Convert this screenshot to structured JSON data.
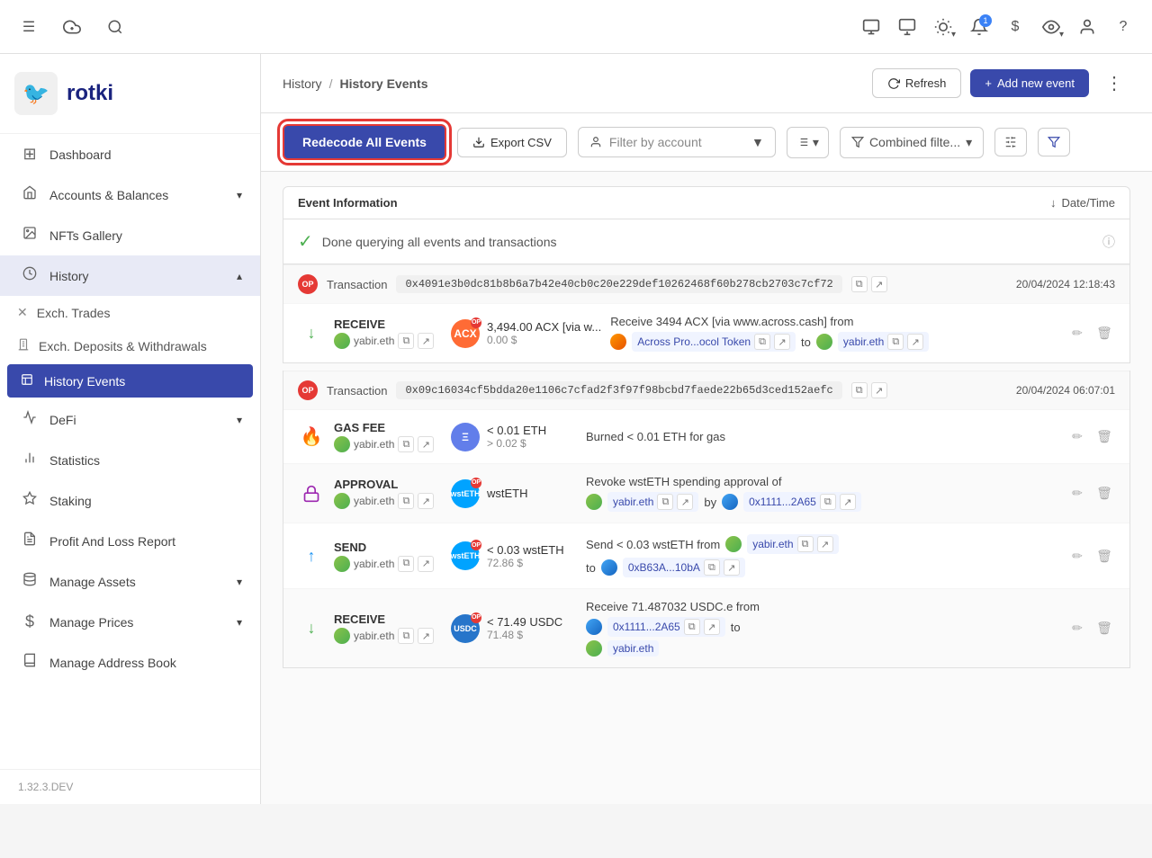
{
  "app": {
    "name": "rotki",
    "version": "1.32.3.DEV"
  },
  "topnav": {
    "icons": [
      "code-icon",
      "display-icon",
      "theme-icon",
      "notification-icon",
      "currency-icon",
      "eye-icon",
      "account-icon",
      "help-icon"
    ],
    "notification_count": "1"
  },
  "sidebar": {
    "items": [
      {
        "id": "dashboard",
        "label": "Dashboard",
        "icon": "⊞"
      },
      {
        "id": "accounts",
        "label": "Accounts & Balances",
        "icon": "☰",
        "expandable": true
      },
      {
        "id": "nfts",
        "label": "NFTs Gallery",
        "icon": "🖼"
      },
      {
        "id": "history",
        "label": "History",
        "icon": "⏱",
        "active": true,
        "expanded": true
      },
      {
        "id": "defi",
        "label": "DeFi",
        "icon": "📈",
        "expandable": true
      },
      {
        "id": "statistics",
        "label": "Statistics",
        "icon": "📊"
      },
      {
        "id": "staking",
        "label": "Staking",
        "icon": "🏆"
      },
      {
        "id": "pnl",
        "label": "Profit And Loss Report",
        "icon": "📋"
      },
      {
        "id": "assets",
        "label": "Manage Assets",
        "icon": "💾",
        "expandable": true
      },
      {
        "id": "prices",
        "label": "Manage Prices",
        "icon": "💲",
        "expandable": true
      },
      {
        "id": "address-book",
        "label": "Manage Address Book",
        "icon": "📒"
      }
    ],
    "sub_items": [
      {
        "id": "exch-trades",
        "label": "Exch. Trades",
        "icon": "✕"
      },
      {
        "id": "exch-deposits",
        "label": "Exch. Deposits & Withdrawals",
        "icon": "🏦"
      },
      {
        "id": "history-events",
        "label": "History Events",
        "active": true
      }
    ]
  },
  "header": {
    "breadcrumb_parent": "History",
    "breadcrumb_sep": "/",
    "breadcrumb_current": "History Events",
    "refresh_label": "Refresh",
    "add_event_label": "Add new event",
    "more_label": "⋮"
  },
  "toolbar": {
    "redecode_label": "Redecode All Events",
    "export_label": "Export CSV",
    "filter_account_placeholder": "Filter by account",
    "filter_combined_label": "Combined filte...",
    "filter_account_chevron": "▼",
    "filter_sort_label": "≡ ▼"
  },
  "table": {
    "col_event": "Event Information",
    "col_datetime": "Date/Time",
    "status_text": "Done querying all events and transactions",
    "transactions": [
      {
        "id": "tx1",
        "type": "Transaction",
        "hash": "0x4091e3b0dc81b8b6a7b42e40cb0c20e229def10262468f60b278cb2703c7cf72",
        "datetime": "20/04/2024 12:18:43",
        "events": [
          {
            "direction": "receive",
            "type": "RECEIVE",
            "account": "yabir.eth",
            "token_symbol": "ACX",
            "token_color": "acx",
            "amount": "3,494.00 ACX [via w...",
            "usd": "0.00 $",
            "description": "Receive 3494 ACX [via www.across.cash] from",
            "from_name": "Across Pro...ocol Token",
            "to_label": "to",
            "to_name": "yabir.eth"
          }
        ]
      },
      {
        "id": "tx2",
        "type": "Transaction",
        "hash": "0x09c16034cf5bdda20e1106c7cfad2f3f97f98bcbd7faede22b65d3ced152aefc",
        "datetime": "20/04/2024 06:07:01",
        "events": [
          {
            "direction": "gas",
            "type": "GAS FEE",
            "account": "yabir.eth",
            "token_symbol": "ETH",
            "token_color": "eth",
            "amount": "< 0.01 ETH",
            "usd": "> 0.02 $",
            "description": "Burned < 0.01 ETH for gas"
          },
          {
            "direction": "approval",
            "type": "APPROVAL",
            "account": "yabir.eth",
            "token_symbol": "wstETH",
            "token_color": "wsteth",
            "amount": "wstETH",
            "usd": "",
            "description": "Revoke wstETH spending approval of",
            "from_name": "yabir.eth",
            "by_label": "by",
            "by_name": "0x1111...2A65"
          },
          {
            "direction": "send",
            "type": "SEND",
            "account": "yabir.eth",
            "token_symbol": "wstETH",
            "token_color": "wsteth",
            "amount": "< 0.03 wstETH",
            "usd": "72.86 $",
            "description": "Send < 0.03 wstETH from",
            "from_name": "yabir.eth",
            "to_label": "to",
            "to_name": "0xB63A...10bA"
          },
          {
            "direction": "receive",
            "type": "RECEIVE",
            "account": "yabir.eth",
            "token_symbol": "USDC",
            "token_color": "usdc",
            "amount": "< 71.49 USDC",
            "usd": "71.48 $",
            "description": "Receive 71.487032 USDC.e from",
            "from_name": "0x1111...2A65",
            "to_label": "to",
            "to_name": "yabir.eth"
          }
        ]
      }
    ]
  }
}
